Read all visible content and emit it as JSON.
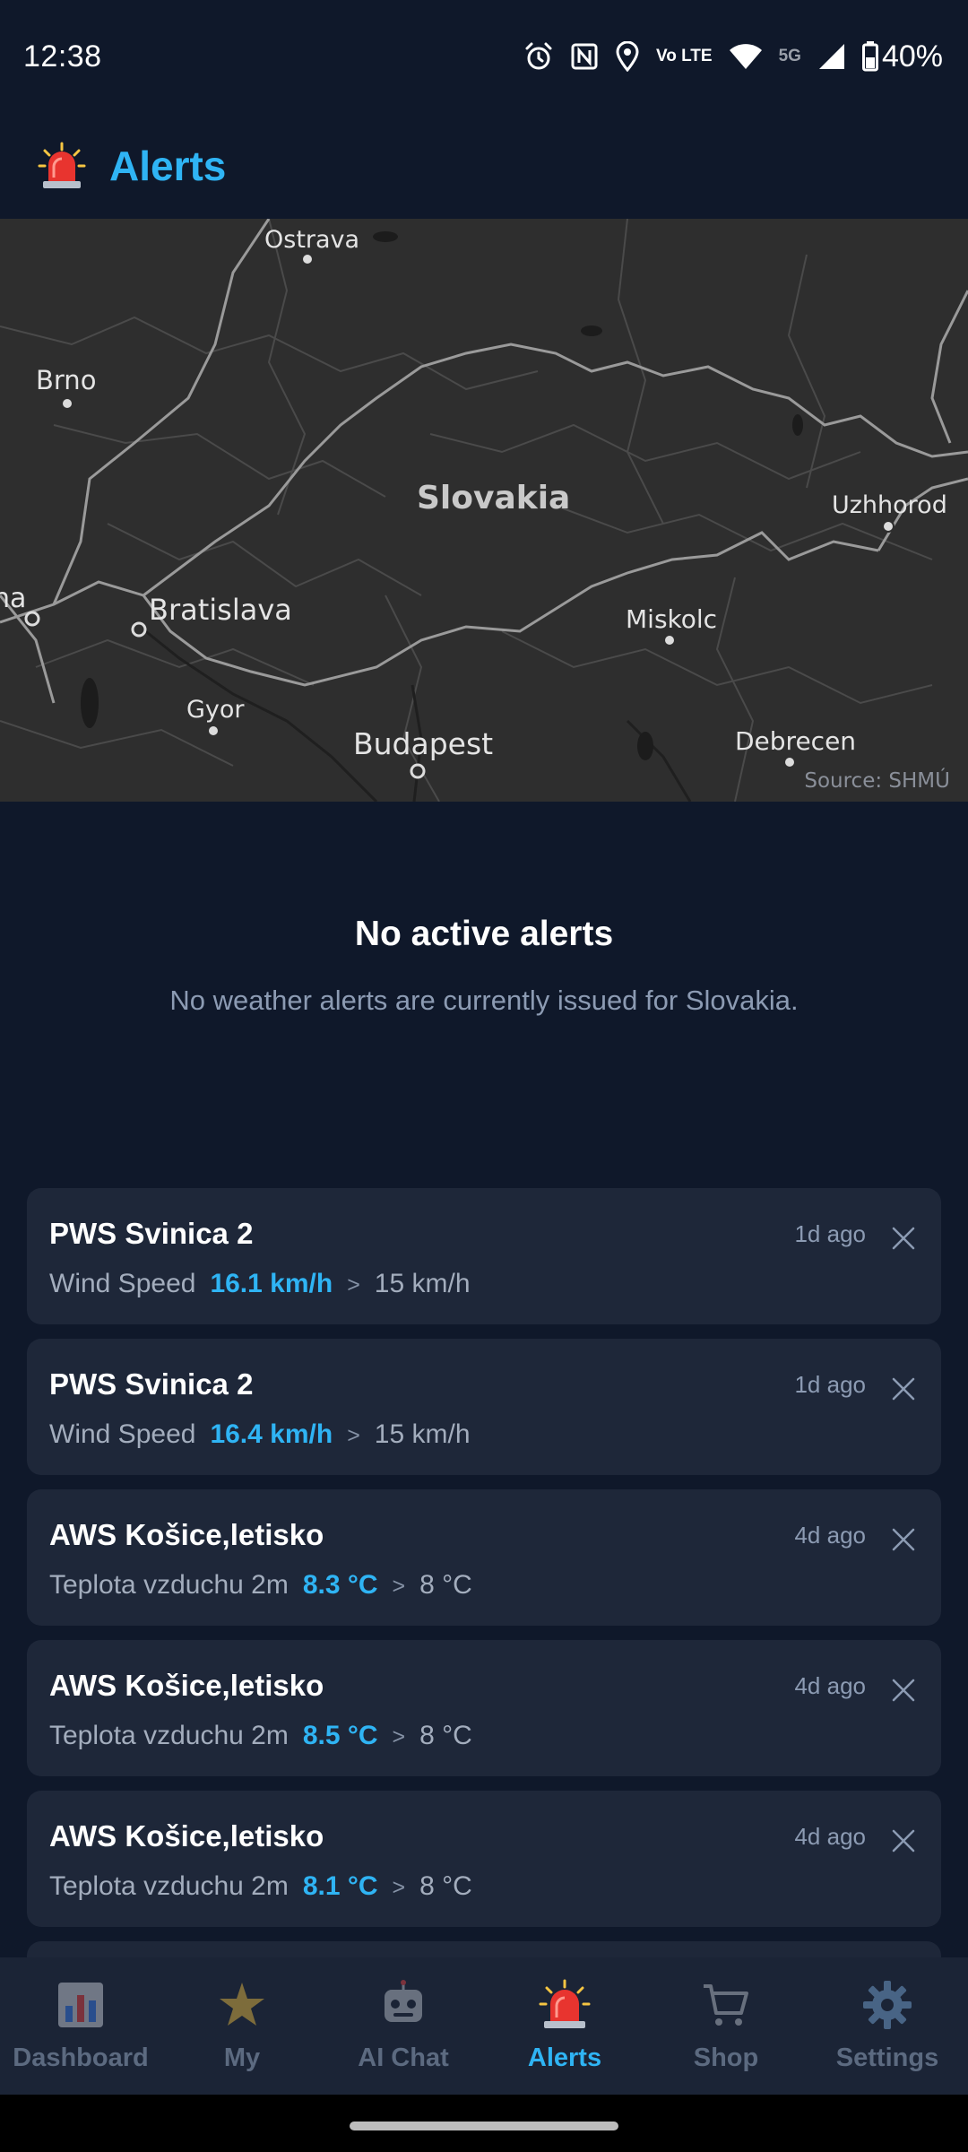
{
  "status_bar": {
    "time": "12:38",
    "network_label": "5G",
    "lte_label": "Vo LTE",
    "battery": "40%",
    "icons": [
      "alarm-icon",
      "nfc-icon",
      "location-icon",
      "volte-icon",
      "wifi-icon",
      "signal-icon",
      "battery-icon"
    ]
  },
  "header": {
    "title": "Alerts",
    "icon": "siren-icon"
  },
  "map": {
    "cities": [
      {
        "name": "Ostrava"
      },
      {
        "name": "Brno"
      },
      {
        "name": "Uzhhorod"
      },
      {
        "name": "Bratislava"
      },
      {
        "name": "Miskolc"
      },
      {
        "name": "Gyor"
      },
      {
        "name": "Budapest"
      },
      {
        "name": "Debrecen"
      },
      {
        "name": "na"
      }
    ],
    "country": "Slovakia",
    "source": "Source: SHMÚ"
  },
  "empty_state": {
    "title": "No active alerts",
    "description": "No weather alerts are currently issued for Slovakia."
  },
  "alerts": [
    {
      "station": "PWS Svinica 2",
      "metric": "Wind Speed",
      "value": "16.1 km/h",
      "operator": ">",
      "threshold": "15 km/h",
      "time": "1d ago"
    },
    {
      "station": "PWS Svinica 2",
      "metric": "Wind Speed",
      "value": "16.4 km/h",
      "operator": ">",
      "threshold": "15 km/h",
      "time": "1d ago"
    },
    {
      "station": "AWS Košice,letisko",
      "metric": "Teplota vzduchu 2m",
      "value": "8.3 °C",
      "operator": ">",
      "threshold": "8 °C",
      "time": "4d ago"
    },
    {
      "station": "AWS Košice,letisko",
      "metric": "Teplota vzduchu 2m",
      "value": "8.5 °C",
      "operator": ">",
      "threshold": "8 °C",
      "time": "4d ago"
    },
    {
      "station": "AWS Košice,letisko",
      "metric": "Teplota vzduchu 2m",
      "value": "8.1 °C",
      "operator": ">",
      "threshold": "8 °C",
      "time": "4d ago"
    }
  ],
  "bottom_nav": {
    "items": [
      {
        "label": "Dashboard",
        "icon": "bar-chart-icon"
      },
      {
        "label": "My",
        "icon": "star-icon"
      },
      {
        "label": "AI Chat",
        "icon": "robot-icon"
      },
      {
        "label": "Alerts",
        "icon": "siren-icon"
      },
      {
        "label": "Shop",
        "icon": "cart-icon"
      },
      {
        "label": "Settings",
        "icon": "gear-icon"
      }
    ],
    "active": "Alerts"
  },
  "colors": {
    "background": "#0f182a",
    "card": "#1e2739",
    "accent": "#2fb4f4",
    "nav_background": "#1b2436",
    "map_background": "#2e2e2e"
  }
}
